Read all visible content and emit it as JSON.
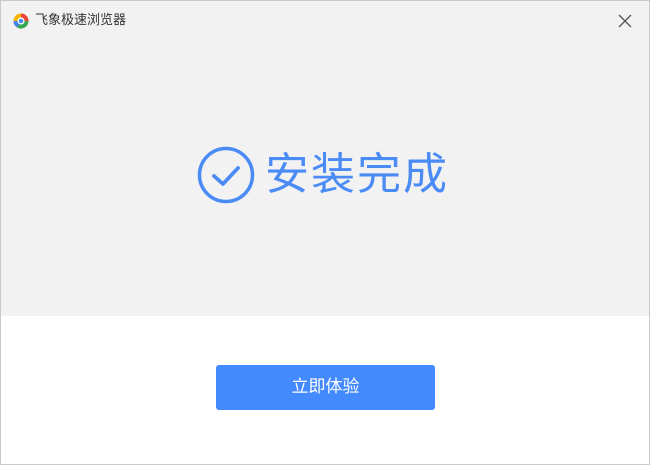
{
  "window": {
    "title": "飞象极速浏览器",
    "close_icon": "close-icon",
    "logo_icon": "browser-logo-icon"
  },
  "status": {
    "icon": "check-circle-icon",
    "text": "安装完成",
    "color": "#4a8bf5"
  },
  "actions": {
    "start_label": "立即体验",
    "button_color": "#448aff"
  },
  "colors": {
    "top_background": "#f2f2f2",
    "bottom_background": "#ffffff"
  }
}
